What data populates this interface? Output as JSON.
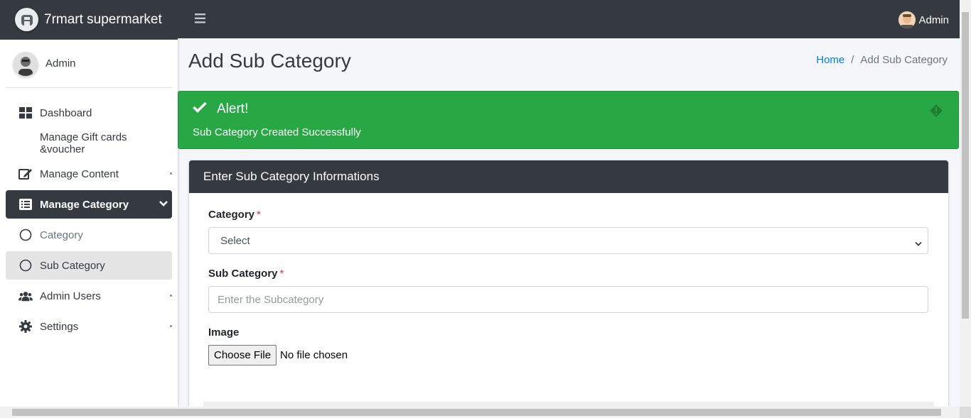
{
  "brand": {
    "name": "7rmart supermarket",
    "logo_icon": "brand-logo-icon"
  },
  "sidebar": {
    "user_name": "Admin",
    "items": [
      {
        "label": "Dashboard",
        "icon": "dashboard-icon"
      },
      {
        "label": "Manage Gift cards &voucher"
      },
      {
        "label": "Manage Content",
        "icon": "edit-icon"
      },
      {
        "label": "Manage Category",
        "icon": "list-icon"
      },
      {
        "label": "Category",
        "icon": "circle-icon"
      },
      {
        "label": "Sub Category",
        "icon": "circle-icon"
      },
      {
        "label": "Admin Users",
        "icon": "users-icon"
      },
      {
        "label": "Settings",
        "icon": "gear-icon"
      }
    ]
  },
  "topbar": {
    "user_name": "Admin"
  },
  "page": {
    "title": "Add Sub Category"
  },
  "breadcrumb": {
    "home": "Home",
    "separator": "/",
    "current": "Add Sub Category"
  },
  "alert": {
    "title": "Alert!",
    "message": "Sub Category Created Successfully",
    "color": "#28a745"
  },
  "form": {
    "header": "Enter Sub Category Informations",
    "category_label": "Category",
    "category_value": "Select",
    "subcategory_label": "Sub Category",
    "subcategory_placeholder": "Enter the Subcategory",
    "image_label": "Image",
    "file_button": "Choose File",
    "file_status": "No file chosen",
    "required_mark": "*"
  },
  "colors": {
    "dark": "#343a40",
    "primary": "#007bff",
    "danger": "#dc3545"
  }
}
